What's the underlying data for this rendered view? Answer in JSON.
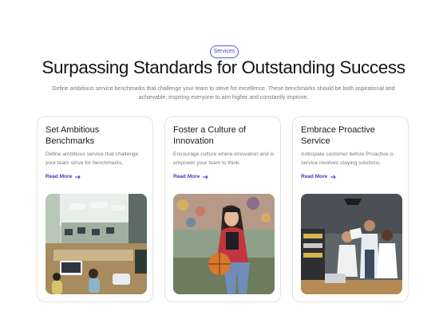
{
  "header": {
    "badge": "Services",
    "title": "Surpassing Standards for Outstanding Success",
    "subtitle": "Define ambitious service benchmarks that challenge your team to strive for excellence. These benchmarks should be both aspirational and achievable, inspiring everyone to aim higher and constantly improve."
  },
  "cards": [
    {
      "title": "Set Ambitious Benchmarks",
      "text": "Define ambitious service that challenge your team strive for benchmarks.",
      "link": "Read More",
      "image": "office-workspace-photo"
    },
    {
      "title": "Foster a Culture of Innovation",
      "text": "Encourage culture where innovation and is empower your team to think.",
      "link": "Read More",
      "image": "woman-with-basketball-photo"
    },
    {
      "title": "Embrace Proactive Service",
      "text": "Anticipate customer before Proactive is service involves staying solutions.",
      "link": "Read More",
      "image": "team-meeting-photo"
    }
  ],
  "colors": {
    "accent": "#3d36c4",
    "badge_border": "#5b55d6",
    "card_border": "#e3e3e3"
  },
  "icons": {
    "link_arrow": "arrow-right-icon"
  }
}
